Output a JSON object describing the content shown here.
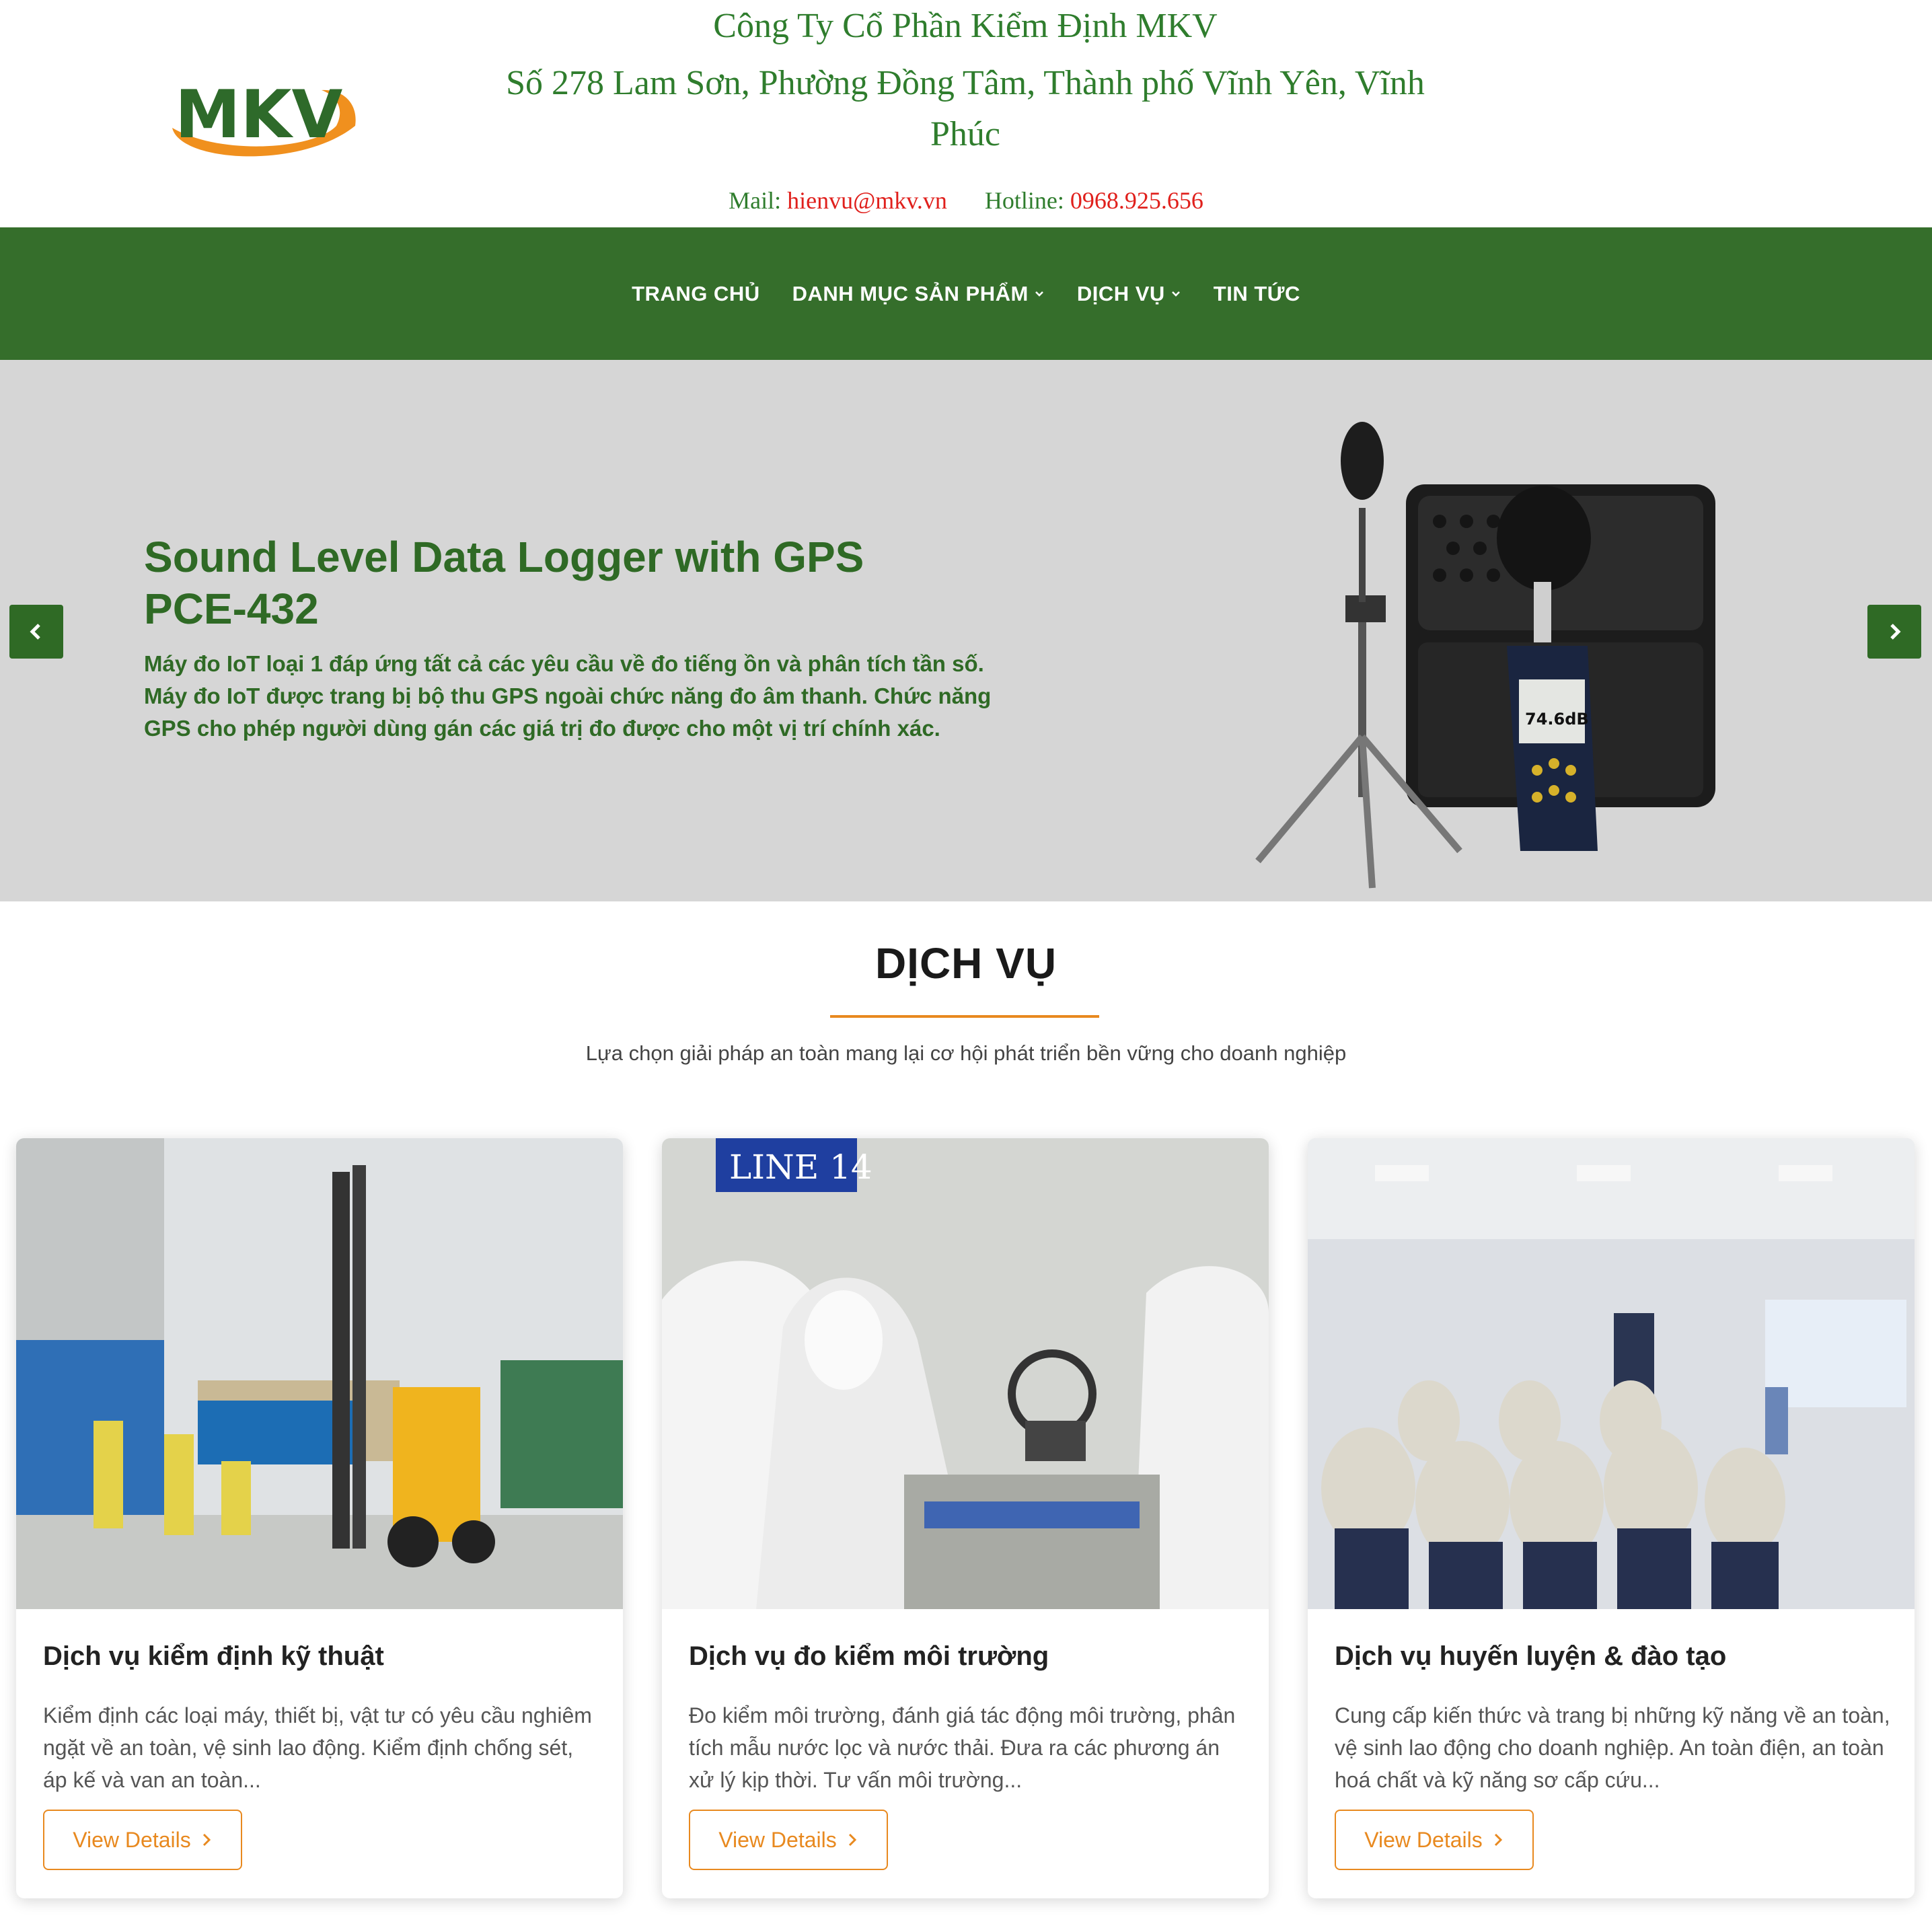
{
  "header": {
    "logo_text": "MKV",
    "company_name": "Công Ty Cổ Phần Kiểm Định MKV",
    "address": "Số 278 Lam Sơn, Phường Đồng Tâm, Thành phố Vĩnh Yên, Vĩnh Phúc",
    "mail_label": "Mail:",
    "mail_value": "hienvu@mkv.vn",
    "hotline_label": "Hotline:",
    "hotline_value": "0968.925.656"
  },
  "nav": {
    "items": [
      {
        "label": "TRANG CHỦ",
        "has_dropdown": false
      },
      {
        "label": "DANH MỤC SẢN PHẨM",
        "has_dropdown": true
      },
      {
        "label": "DỊCH VỤ",
        "has_dropdown": true
      },
      {
        "label": "TIN TỨC",
        "has_dropdown": false
      }
    ]
  },
  "hero": {
    "title": "Sound Level Data Logger with GPS PCE-432",
    "description": "Máy đo IoT loại 1 đáp ứng tất cả các yêu cầu về đo tiếng ồn và phân tích tần số. Máy đo IoT được trang bị bộ thu GPS ngoài chức năng đo âm thanh. Chức năng GPS cho phép người dùng gán các giá trị đo được cho một vị trí chính xác.",
    "meter_reading": "74.6dB"
  },
  "services": {
    "title": "DỊCH VỤ",
    "subtitle": "Lựa chọn giải pháp an toàn mang lại cơ hội phát triển bền vững cho doanh nghiệp",
    "cards": [
      {
        "title": "Dịch vụ kiểm định kỹ thuật",
        "description": "Kiểm định các loại máy, thiết bị, vật tư có yêu cầu nghiêm ngặt về an toàn, vệ sinh lao động. Kiểm định chống sét, áp kế và van an toàn...",
        "button_label": "View Details"
      },
      {
        "title": "Dịch vụ đo kiểm môi trường",
        "description": "Đo kiểm môi trường, đánh giá tác động môi trường, phân tích mẫu nước lọc và nước thải. Đưa ra các phương án xử lý kịp thời. Tư vấn môi trường...",
        "button_label": "View Details",
        "image_sign": "LINE 14"
      },
      {
        "title": "Dịch vụ huyến luyện & đào tạo",
        "description": "Cung cấp kiến thức và trang bị những kỹ năng về an toàn, vệ sinh lao động cho doanh nghiệp. An toàn điện, an toàn hoá chất và kỹ năng sơ cấp cứu...",
        "button_label": "View Details"
      }
    ]
  },
  "colors": {
    "brand_green": "#356e2b",
    "text_green": "#2f7d2d",
    "accent_orange": "#e8891f",
    "hotline_red": "#e0201c",
    "hero_bg": "#d6d6d6"
  },
  "icons": [
    "chevron-down-icon",
    "chevron-left-icon",
    "chevron-right-icon"
  ]
}
